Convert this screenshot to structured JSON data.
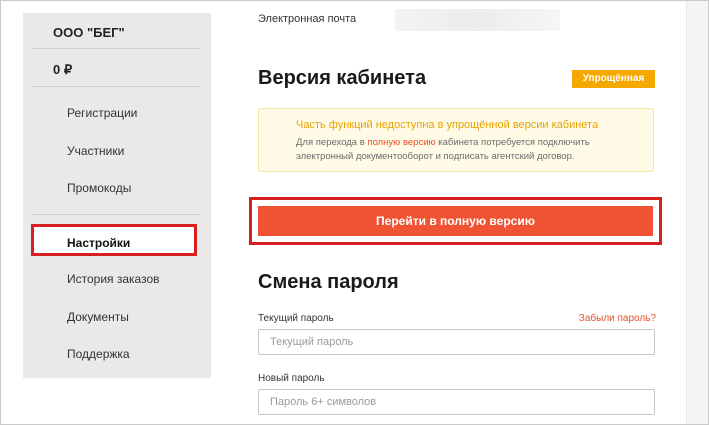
{
  "sidebar": {
    "company": "ООО \"БЕГ\"",
    "balance": "0 ₽",
    "items": [
      {
        "label": "Регистрации"
      },
      {
        "label": "Участники"
      },
      {
        "label": "Промокоды"
      },
      {
        "label": "Настройки",
        "active": true
      },
      {
        "label": "История заказов"
      },
      {
        "label": "Документы"
      },
      {
        "label": "Поддержка"
      }
    ]
  },
  "main": {
    "email_label": "Электронная почта",
    "cabinet": {
      "title": "Версия кабинета",
      "badge": "Упрощённая",
      "notice_title": "Часть функций недоступна в упрощённой версии кабинета",
      "notice_text_before": "Для перехода в ",
      "notice_link": "полную версию",
      "notice_text_after": " кабинета потребуется подключить электронный документооборот и подписать агентский договор.",
      "cta": "Перейти в полную версию"
    },
    "password": {
      "title": "Смена пароля",
      "current_label": "Текущий пароль",
      "forgot": "Забыли пароль?",
      "current_placeholder": "Текущий пароль",
      "new_label": "Новый пароль",
      "new_placeholder": "Пароль 6+ символов"
    }
  },
  "colors": {
    "accent": "#f05234",
    "highlight": "#d81e1e",
    "badge": "#f5a800",
    "notice_bg": "#fffbe6"
  }
}
